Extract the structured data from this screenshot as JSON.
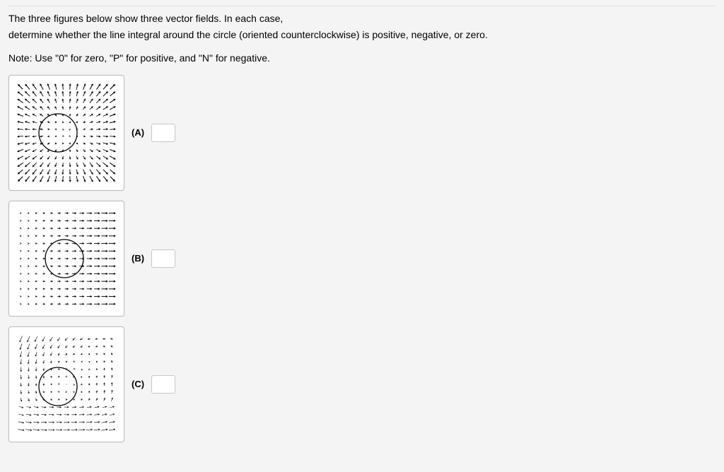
{
  "intro": {
    "line1": "The three figures below show three vector fields. In each case,",
    "line2": "determine whether the line integral around the circle (oriented counterclockwise) is positive, negative, or zero.",
    "note": "Note: Use \"0\" for zero, \"P\" for positive, and \"N\" for negative."
  },
  "parts": {
    "a": {
      "label": "(A)",
      "value": ""
    },
    "b": {
      "label": "(B)",
      "value": ""
    },
    "c": {
      "label": "(C)",
      "value": ""
    }
  },
  "fields": {
    "a": {
      "type": "radial-outward",
      "grid": 14,
      "circle_cx": 0.42,
      "circle_cy": 0.5,
      "circle_r": 0.18
    },
    "b": {
      "type": "shear-right",
      "grid": 13,
      "circle_cx": 0.48,
      "circle_cy": 0.5,
      "circle_r": 0.18
    },
    "c": {
      "type": "rotational-cw",
      "grid": 13,
      "circle_cx": 0.42,
      "circle_cy": 0.52,
      "circle_r": 0.18
    }
  }
}
